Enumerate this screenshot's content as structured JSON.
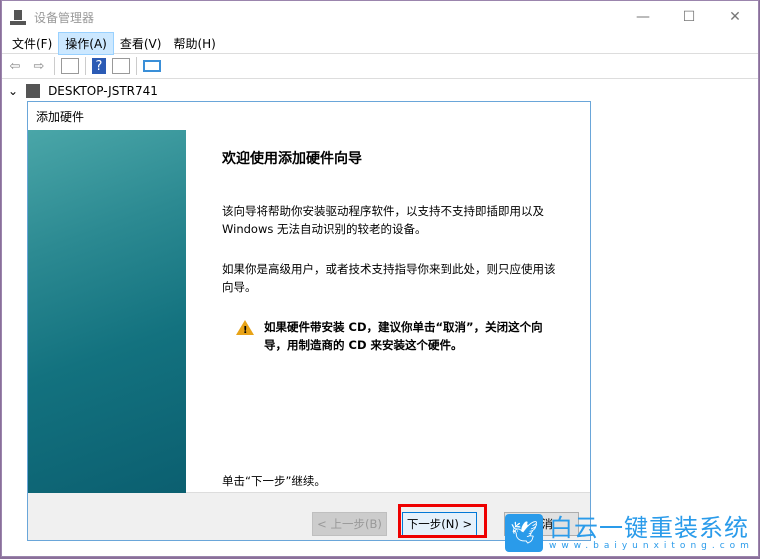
{
  "window": {
    "title": "设备管理器",
    "minimize": "—",
    "maximize": "☐",
    "close": "✕"
  },
  "menu": [
    {
      "label": "文件(F)"
    },
    {
      "label": "操作(A)"
    },
    {
      "label": "查看(V)"
    },
    {
      "label": "帮助(H)"
    }
  ],
  "tree": {
    "expander": "⌄",
    "root": "DESKTOP-JSTR741"
  },
  "dialog": {
    "title": "添加硬件",
    "heading": "欢迎使用添加硬件向导",
    "para1": "该向导将帮助你安装驱动程序软件，以支持不支持即插即用以及 Windows 无法自动识别的较老的设备。",
    "para2": "如果你是高级用户，或者技术支持指导你来到此处，则只应使用该向导。",
    "warning": "如果硬件带安装 CD，建议你单击“取消”，关闭这个向导，用制造商的 CD 来安装这个硬件。",
    "continue": "单击“下一步”继续。",
    "back": "< 上一步(B)",
    "next": "下一步(N) >",
    "cancel": "取消"
  },
  "watermark": {
    "title": "白云一键重装系统",
    "url": "www.baiyunxitong.com"
  },
  "colors": {
    "highlight": "#ee0000",
    "accent": "#0078d7"
  }
}
